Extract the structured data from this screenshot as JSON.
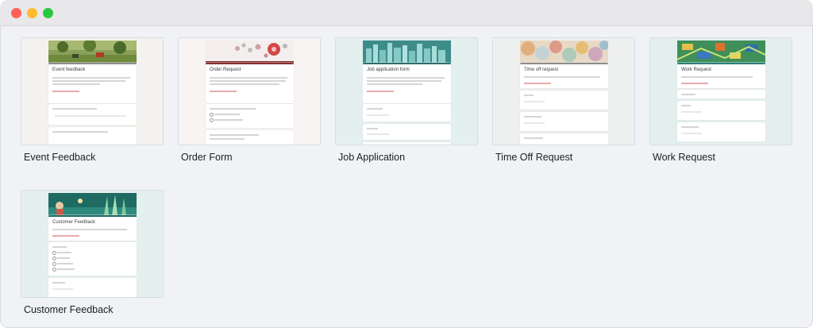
{
  "window": {
    "lights": {
      "close": "#ff5f57",
      "minimize": "#febc2e",
      "zoom": "#28c840"
    }
  },
  "templates": [
    {
      "label": "Event Feedback",
      "form_title": "Event feedback",
      "bg": "#f4f2ee",
      "accent": "#7a6a4a"
    },
    {
      "label": "Order Form",
      "form_title": "Order Request",
      "bg": "#f7f4f3",
      "accent": "#a04444"
    },
    {
      "label": "Job Application",
      "form_title": "Job application form",
      "bg": "#e4f0ef",
      "accent": "#3c7a78"
    },
    {
      "label": "Time Off Request",
      "form_title": "Time off request",
      "bg": "#eef0f0",
      "accent": "#6a6a6a"
    },
    {
      "label": "Work Request",
      "form_title": "Work Request",
      "bg": "#e3efee",
      "accent": "#3a8a88"
    },
    {
      "label": "Customer Feedback",
      "form_title": "Customer Feedback",
      "bg": "#e4f0ed",
      "accent": "#2f7a72"
    }
  ]
}
